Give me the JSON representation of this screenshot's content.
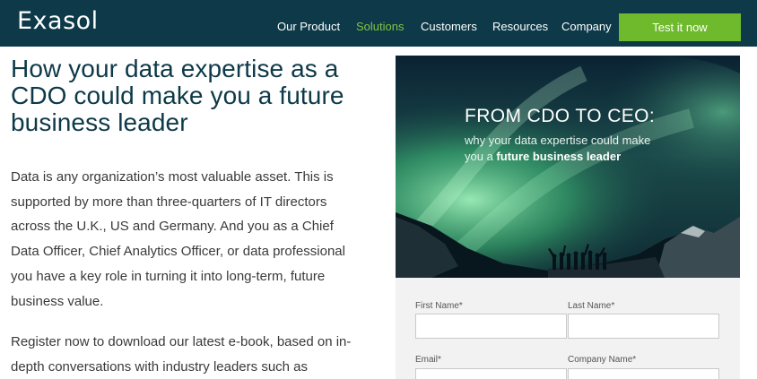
{
  "header": {
    "logo_text": "Exasol",
    "nav": [
      {
        "label": "Our Product",
        "active": false
      },
      {
        "label": "Solutions",
        "active": true
      },
      {
        "label": "Customers",
        "active": false
      },
      {
        "label": "Resources",
        "active": false
      },
      {
        "label": "Company",
        "active": false
      }
    ],
    "cta_label": "Test it now"
  },
  "main": {
    "headline": "How your data expertise as a CDO could make you a future business leader",
    "paragraph_1": "Data is any organization’s most valuable asset. This is supported by more than three-quarters of IT directors across the U.K., US and Germany. And you as a Chief Data Officer, Chief Analytics Officer, or data professional you have a key role in turning it into long-term, future business value.",
    "paragraph_2": "Register now to download our latest e-book, based on in-depth conversations with industry leaders such as"
  },
  "hero": {
    "title": "FROM CDO TO CEO:",
    "subtitle_1": "why your data expertise could make",
    "subtitle_2": "you a ",
    "subtitle_bold": "future business leader"
  },
  "form": {
    "first_name_label": "First Name*",
    "last_name_label": "Last Name*",
    "email_label": "Email*",
    "company_label": "Company Name*",
    "first_name_value": "",
    "last_name_value": "",
    "email_value": "",
    "company_value": ""
  },
  "colors": {
    "header_bg": "#0d3948",
    "accent_green": "#6fba2c",
    "active_nav": "#82c341",
    "headline": "#0d3948"
  }
}
